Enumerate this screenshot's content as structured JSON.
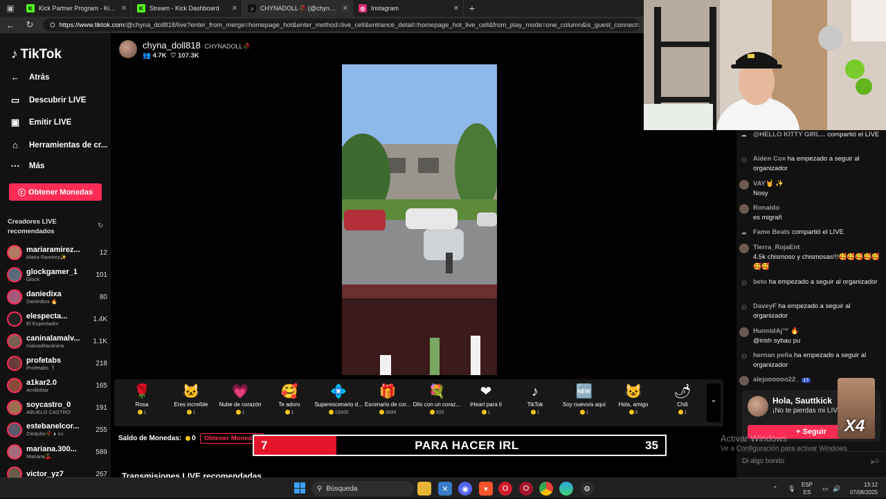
{
  "browser": {
    "tabs": [
      {
        "title": "Kick Partner Program - Kick Dash",
        "fav_color": "#53fc18",
        "fav_text": "K"
      },
      {
        "title": "Stream - Kick Dashboard",
        "fav_color": "#53fc18",
        "fav_text": "K"
      },
      {
        "title": "CHYNADOLL🥀 (@chyna_d",
        "fav_color": "#111111",
        "fav_text": "♪",
        "active": true
      },
      {
        "title": "Instagram",
        "fav_color": "#d62976",
        "fav_text": "◎"
      }
    ],
    "url_domain": "https://www.tiktok.com",
    "url_path": "/@chyna_doll818/live?enter_from_merge=homepage_hot&enter_method=live_cell&entrance_detail=homepage_hot_live_cell&from_play_mode=one_column&is_guest_connect=0"
  },
  "sidebar": {
    "logo": "TikTok",
    "nav": [
      {
        "label": "Atrás",
        "icon": "back-arrow-icon"
      },
      {
        "label": "Descubrir LIVE",
        "icon": "live-tv-icon"
      },
      {
        "label": "Emitir LIVE",
        "icon": "camera-icon"
      },
      {
        "label": "Herramientas de cr...",
        "icon": "home-tools-icon"
      },
      {
        "label": "Más",
        "icon": "more-dots-icon"
      }
    ],
    "coins_button": "Obtener Monedas",
    "recommended_title": "Creadores LIVE recomendados",
    "creators": [
      {
        "name": "mariaramirez...",
        "sub": "Maria Ramirez✨",
        "count": "12",
        "color": "#b07a63"
      },
      {
        "name": "glockgamer_1",
        "sub": "Glock",
        "count": "101",
        "color": "#5a6a7a"
      },
      {
        "name": "daniedixa",
        "sub": "Daniedixa 🔥",
        "count": "80",
        "color": "#a35a7a"
      },
      {
        "name": "elespecta...",
        "sub": "El Espectador",
        "count": "1.4K",
        "color": "#222222"
      },
      {
        "name": "caninalamalv...",
        "sub": "malvaditacanina",
        "count": "1.1K",
        "color": "#7a6050"
      },
      {
        "name": "profetabs",
        "sub": "Profetabs 🕴",
        "count": "218",
        "color": "#6b3a3a"
      },
      {
        "name": "a1kar2.0",
        "sub": "Amilkiiitar",
        "count": "165",
        "color": "#8a4a3a"
      },
      {
        "name": "soycastro_0",
        "sub": "ABUELO CASTRO",
        "count": "191",
        "color": "#9a7050"
      },
      {
        "name": "estebanelcor...",
        "sub": "Zarquito🥀 🌢 cu",
        "count": "255",
        "color": "#5a5a6a"
      },
      {
        "name": "mariana.300...",
        "sub": "Mariana🍒",
        "count": "589",
        "color": "#a66b7a"
      },
      {
        "name": "victor_yz7",
        "sub": "",
        "count": "267",
        "color": "#6a5a4a"
      }
    ]
  },
  "stream": {
    "host_name": "chyna_doll818",
    "host_nick": "CHYNADOLL🥀",
    "viewers": "4.7K",
    "likes": "107.3K"
  },
  "gifts": [
    {
      "name": "Rosa",
      "price": "1",
      "icon": "🌹"
    },
    {
      "name": "Eres increíble",
      "price": "1",
      "icon": "🐱"
    },
    {
      "name": "Nube de corazón",
      "price": "1",
      "icon": "💗"
    },
    {
      "name": "Te adoro",
      "price": "1",
      "icon": "🥰"
    },
    {
      "name": "Superescenario d...",
      "price": "15000",
      "icon": "💠"
    },
    {
      "name": "Escenario de cor...",
      "price": "3999",
      "icon": "🎁"
    },
    {
      "name": "Dilo con un coraz...",
      "price": "500",
      "icon": "💐"
    },
    {
      "name": "iHeart para ti",
      "price": "1",
      "icon": "❤"
    },
    {
      "name": "TikTok",
      "price": "1",
      "icon": "♪"
    },
    {
      "name": "Soy nuevo/a aquí",
      "price": "1",
      "icon": "🆕"
    },
    {
      "name": "Hola, amigo",
      "price": "5",
      "icon": "😺"
    },
    {
      "name": "Chili",
      "price": "1",
      "icon": "🌶"
    }
  ],
  "balance": {
    "label": "Saldo de Monedas:",
    "amount": "0",
    "button": "Obtener Monedas"
  },
  "goal_bar": {
    "left": "7",
    "text": "PARA HACER IRL",
    "right": "35",
    "progress": 0.2
  },
  "recommended_section": "Transmisiones LIVE recomendadas",
  "chat": {
    "messages": [
      {
        "user": "@HELLO KITTY GIRL...",
        "text": " compartió el LIVE",
        "icon": "share-icon"
      },
      {
        "user": "Aiden Cox",
        "text": " ha empezado a seguir al organizador",
        "icon": "follow-icon"
      },
      {
        "user": "VAY🤘 ✨",
        "text": "Nosy",
        "icon": "user-avatar",
        "newline": true
      },
      {
        "user": "Ronaldo",
        "text": "es migrañ",
        "icon": "user-avatar",
        "newline": true
      },
      {
        "user": "Fame Beats",
        "text": " compartió el LIVE",
        "icon": "share-icon"
      },
      {
        "user": "Tierra_RojaEnt",
        "text": "4.5k chismoso y chismosas!!!🥰🥰🥰🥰🥰🥰🥰",
        "icon": "user-avatar",
        "newline": true
      },
      {
        "user": "beto",
        "text": " ha empezado a seguir al organizador",
        "icon": "follow-icon"
      },
      {
        "user": "DaveyF",
        "text": " ha empezado a seguir al organizador",
        "icon": "follow-icon"
      },
      {
        "user": "HunnidAj™ 🔥",
        "text": "@irish sybau pu",
        "icon": "user-avatar",
        "newline": true
      },
      {
        "user": "hernan peña",
        "text": " ha empezado a seguir al organizador",
        "icon": "follow-icon"
      },
      {
        "user": "alejoooooo22_",
        "text": "",
        "icon": "user-avatar",
        "badge": "17"
      }
    ],
    "popup_title": "Hola, Sauttkick",
    "popup_sub": "¡No te pierdas mi LIVE!",
    "follow_button": "+ Seguir",
    "multiplier": "X4",
    "input_placeholder": "Di algo bonito"
  },
  "watermark": {
    "line1": "Activar Windows",
    "line2": "Ve a Configuración para activar Windows."
  },
  "taskbar": {
    "search": "Búsqueda",
    "lang_line1": "ESP",
    "lang_line2": "ES",
    "time": "13:12",
    "date": "07/08/2025"
  }
}
